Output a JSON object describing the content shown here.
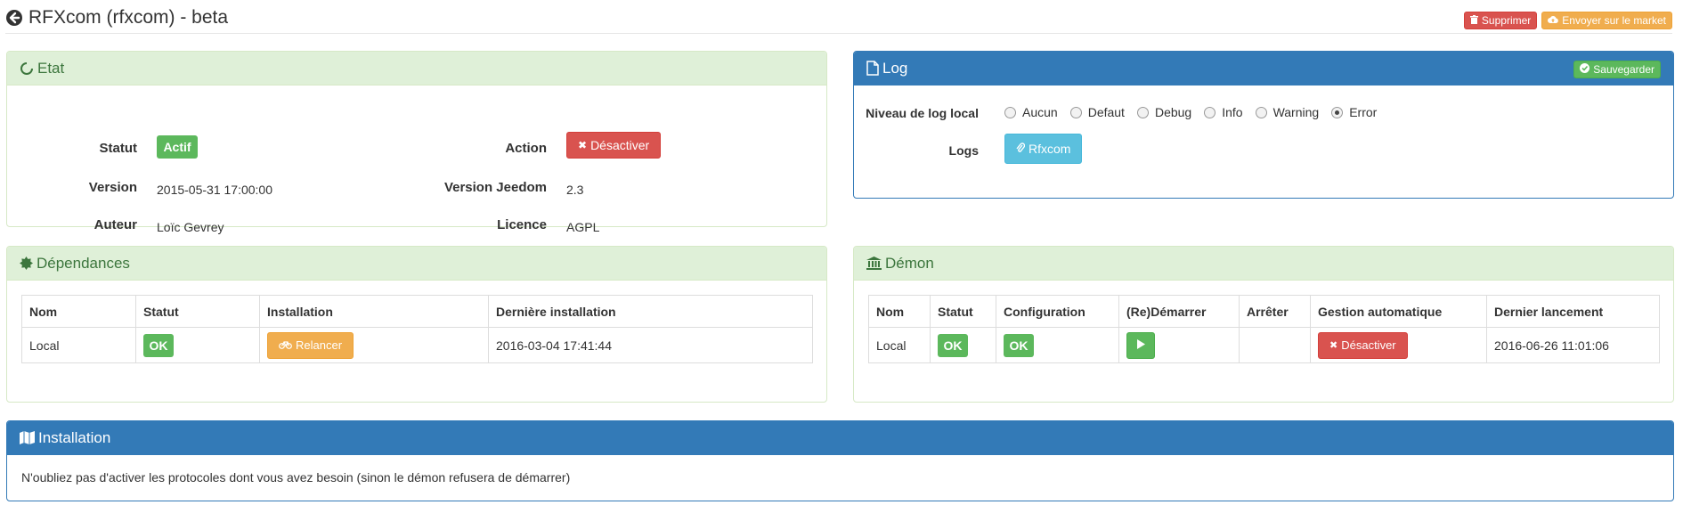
{
  "header": {
    "title": "RFXcom (rfxcom) - beta",
    "delete_label": "Supprimer",
    "market_label": "Envoyer sur le market"
  },
  "etat": {
    "title": "Etat",
    "statut_label": "Statut",
    "statut_value": "Actif",
    "action_label": "Action",
    "action_button": "Désactiver",
    "version_label": "Version",
    "version_value": "2015-05-31 17:00:00",
    "jeedom_label": "Version Jeedom",
    "jeedom_value": "2.3",
    "auteur_label": "Auteur",
    "auteur_value": "Loïc Gevrey",
    "licence_label": "Licence",
    "licence_value": "AGPL"
  },
  "log": {
    "title": "Log",
    "save_label": "Sauvegarder",
    "level_label": "Niveau de log local",
    "levels": [
      "Aucun",
      "Defaut",
      "Debug",
      "Info",
      "Warning",
      "Error"
    ],
    "selected_level": "Error",
    "logs_label": "Logs",
    "logs_button": "Rfxcom"
  },
  "dependances": {
    "title": "Dépendances",
    "columns": [
      "Nom",
      "Statut",
      "Installation",
      "Dernière installation"
    ],
    "row": {
      "nom": "Local",
      "statut": "OK",
      "installation": "Relancer",
      "derniere": "2016-03-04 17:41:44"
    }
  },
  "demon": {
    "title": "Démon",
    "columns": [
      "Nom",
      "Statut",
      "Configuration",
      "(Re)Démarrer",
      "Arrêter",
      "Gestion automatique",
      "Dernier lancement"
    ],
    "row": {
      "nom": "Local",
      "statut": "OK",
      "configuration": "OK",
      "gestion": "Désactiver",
      "dernier": "2016-06-26 11:01:06"
    }
  },
  "installation": {
    "title": "Installation",
    "text": "N'oubliez pas d'activer les protocoles dont vous avez besoin (sinon le démon refusera de démarrer)"
  },
  "colors": {
    "success": "#5cb85c",
    "danger": "#d9534f",
    "warning": "#f0ad4e",
    "info": "#5bc0de",
    "primary": "#337ab7",
    "panel_success_bg": "#dff0d8"
  }
}
